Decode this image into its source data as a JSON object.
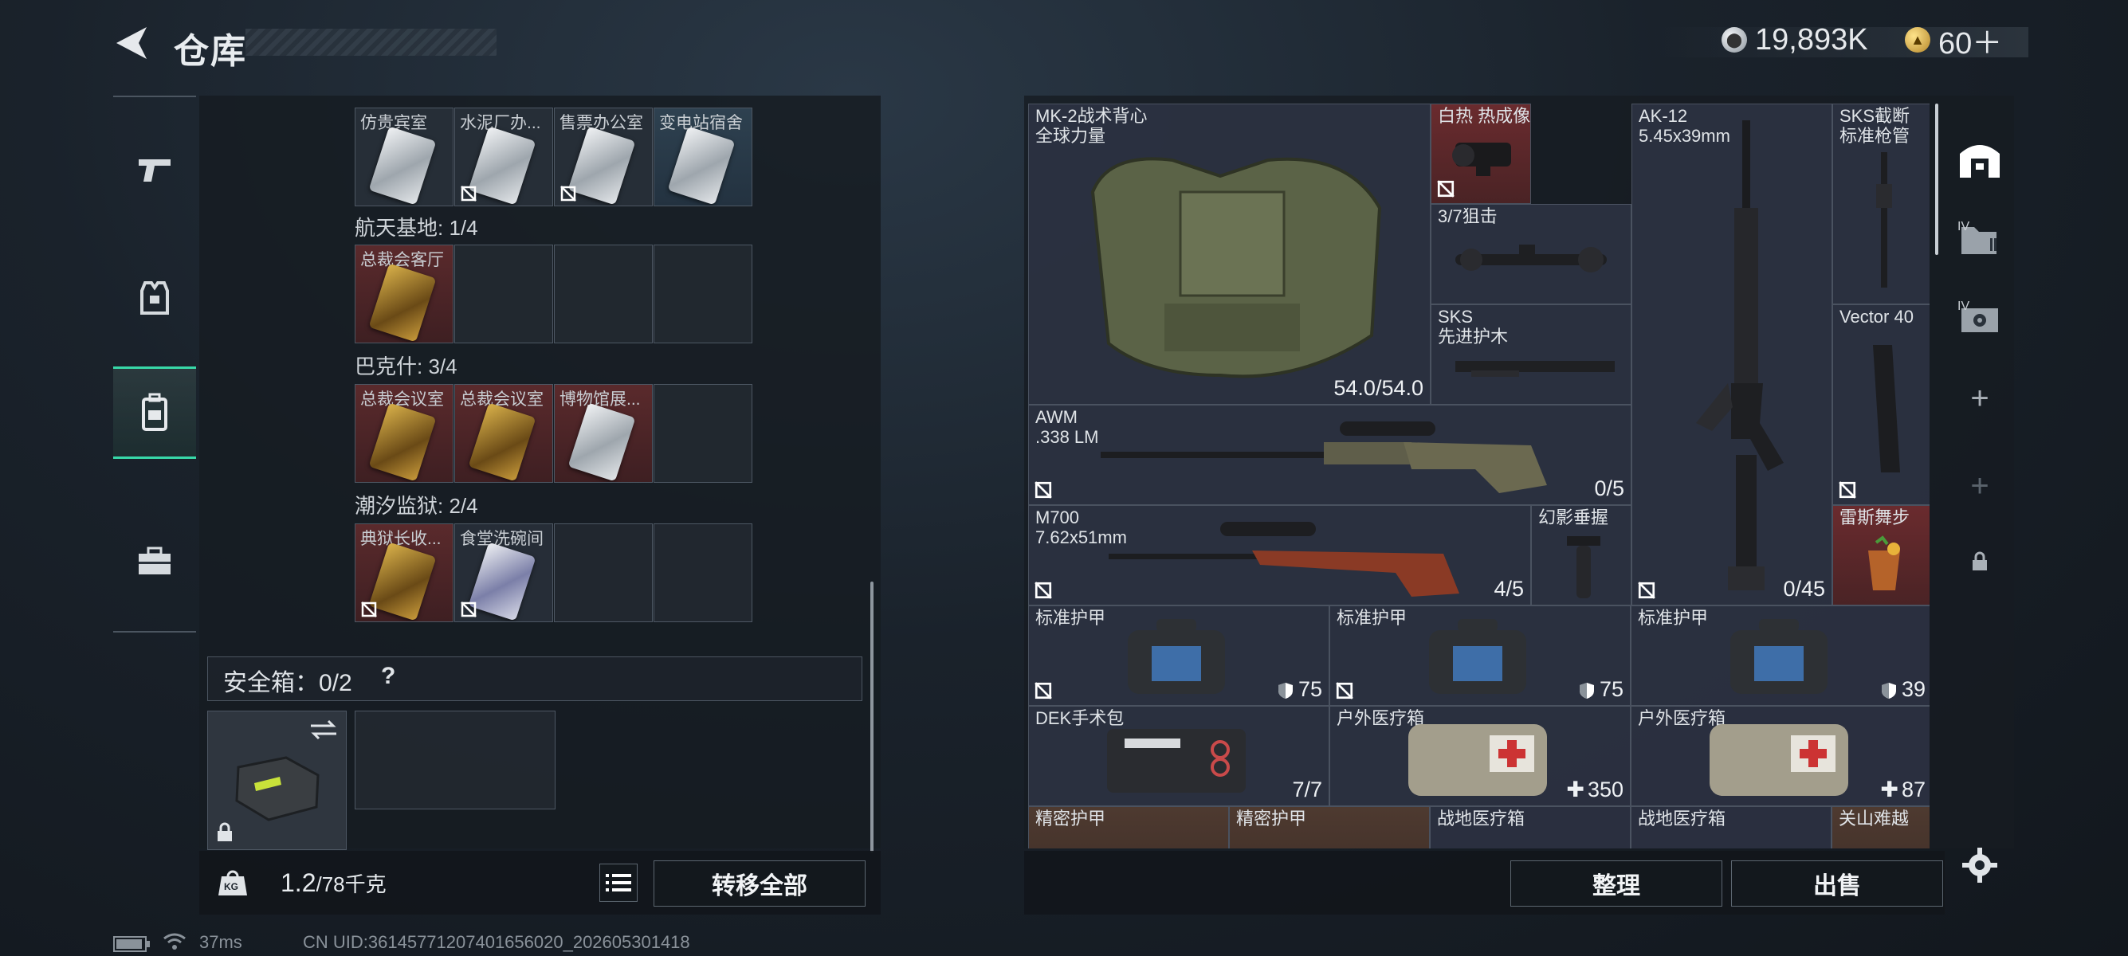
{
  "header": {
    "title": "仓库",
    "currency_silver": "19,893K",
    "currency_gold": "60＋"
  },
  "left_panel": {
    "row0": [
      "仿贵宾室",
      "水泥厂办...",
      "售票办公室",
      "变电站宿舍"
    ],
    "section1": "航天基地: 1/4",
    "row1": [
      "总裁会客厅"
    ],
    "section2": "巴克什: 3/4",
    "row2": [
      "总裁会议室",
      "总裁会议室",
      "博物馆展..."
    ],
    "section3": "潮汐监狱: 2/4",
    "row3": [
      "典狱长收...",
      "食堂洗碗间"
    ],
    "safebox_label": "安全箱：0/2",
    "safebox_help": "?",
    "weight_value": "1.2",
    "weight_total": "/78千克",
    "weight_badge": "KG",
    "transfer_all": "转移全部"
  },
  "items": [
    {
      "name": "MK-2战术背心",
      "sub": "全球力量",
      "count": "54.0/54.0"
    },
    {
      "name": "白热 热成像",
      "sub": "",
      "count": ""
    },
    {
      "name": "3/7狙击",
      "sub": "",
      "count": ""
    },
    {
      "name": "SKS",
      "sub": "先进护木",
      "count": ""
    },
    {
      "name": "AK-12",
      "sub": "5.45x39mm",
      "count": "0/45"
    },
    {
      "name": "SKS截断",
      "sub": "标准枪管",
      "count": ""
    },
    {
      "name": "Vector 40",
      "sub": "",
      "count": ""
    },
    {
      "name": "AWM",
      "sub": ".338 LM",
      "count": "0/5"
    },
    {
      "name": "M700",
      "sub": "7.62x51mm",
      "count": "4/5"
    },
    {
      "name": "幻影垂握",
      "sub": "",
      "count": ""
    },
    {
      "name": "雷斯舞步",
      "sub": "",
      "count": ""
    },
    {
      "name": "标准护甲",
      "sub": "",
      "count": "75"
    },
    {
      "name": "标准护甲",
      "sub": "",
      "count": "75"
    },
    {
      "name": "标准护甲",
      "sub": "",
      "count": "39"
    },
    {
      "name": "DEK手术包",
      "sub": "",
      "count": "7/7"
    },
    {
      "name": "户外医疗箱",
      "sub": "",
      "count": "350"
    },
    {
      "name": "户外医疗箱",
      "sub": "",
      "count": "87"
    },
    {
      "name": "精密护甲",
      "sub": "",
      "count": ""
    },
    {
      "name": "精密护甲",
      "sub": "",
      "count": ""
    },
    {
      "name": "战地医疗箱",
      "sub": "",
      "count": ""
    },
    {
      "name": "战地医疗箱",
      "sub": "",
      "count": ""
    },
    {
      "name": "关山难越",
      "sub": "",
      "count": ""
    }
  ],
  "right_actions": {
    "sort": "整理",
    "sell": "出售"
  },
  "side_tabs": {
    "tab_iv_1": "IV",
    "tab_iv_2": "IV"
  },
  "status": {
    "ping": "37ms",
    "uid": "CN UID:36145771207401656020_202605301418"
  },
  "colors": {
    "accent": "#38d8a8",
    "red_rarity": "#6a2b2e",
    "blue_rarity": "#2e4150"
  }
}
